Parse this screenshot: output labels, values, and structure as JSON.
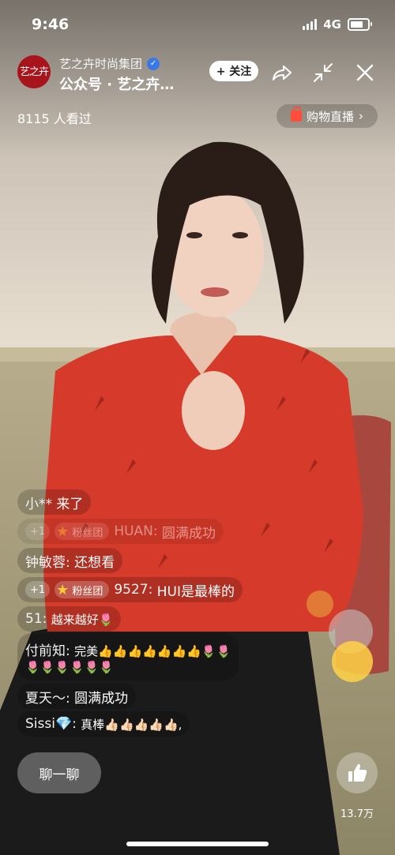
{
  "status_bar": {
    "time": "9:46",
    "network": "4G"
  },
  "header": {
    "avatar_text": "艺之卉",
    "account_name": "艺之卉时尚集团",
    "subtitle": "公众号 · 艺之卉…",
    "follow_label": "+ 关注",
    "viewers": "8115 人看过",
    "shop_live_label": "购物直播",
    "shop_live_chevron": "›"
  },
  "comments": [
    {
      "name": "小**",
      "text": "来了"
    },
    {
      "plus": "+1",
      "fan": "粉丝团",
      "name": "HUAN:",
      "text": "圆满成功"
    },
    {
      "name": "钟敏蓉:",
      "text": "还想看"
    },
    {
      "plus": "+1",
      "fan": "粉丝团",
      "name": "9527:",
      "text": "HUI是最棒的"
    },
    {
      "name": "51:",
      "text": "越来越好🌷"
    },
    {
      "name": "付前知:",
      "text": "完美👍👍👍👍👍👍👍🌷🌷"
    },
    {
      "name": "",
      "text": "🌷🌷🌷🌷🌷🌷"
    },
    {
      "name": "夏天～:",
      "text": "圆满成功"
    },
    {
      "name": "Sissi💎:",
      "text": "真棒👍🏻👍🏻👍🏻👍🏻👍🏻,"
    }
  ],
  "bottom": {
    "chat_label": "聊一聊",
    "like_count": "13.7万"
  },
  "colors": {
    "accent_red": "#d63a2a",
    "avatar_bg": "#a8141b",
    "verified": "#3b78e7"
  },
  "icons": [
    "verified-icon",
    "share-icon",
    "minimize-icon",
    "close-icon",
    "shopping-bag-icon",
    "thumbs-up-icon",
    "star-icon"
  ]
}
